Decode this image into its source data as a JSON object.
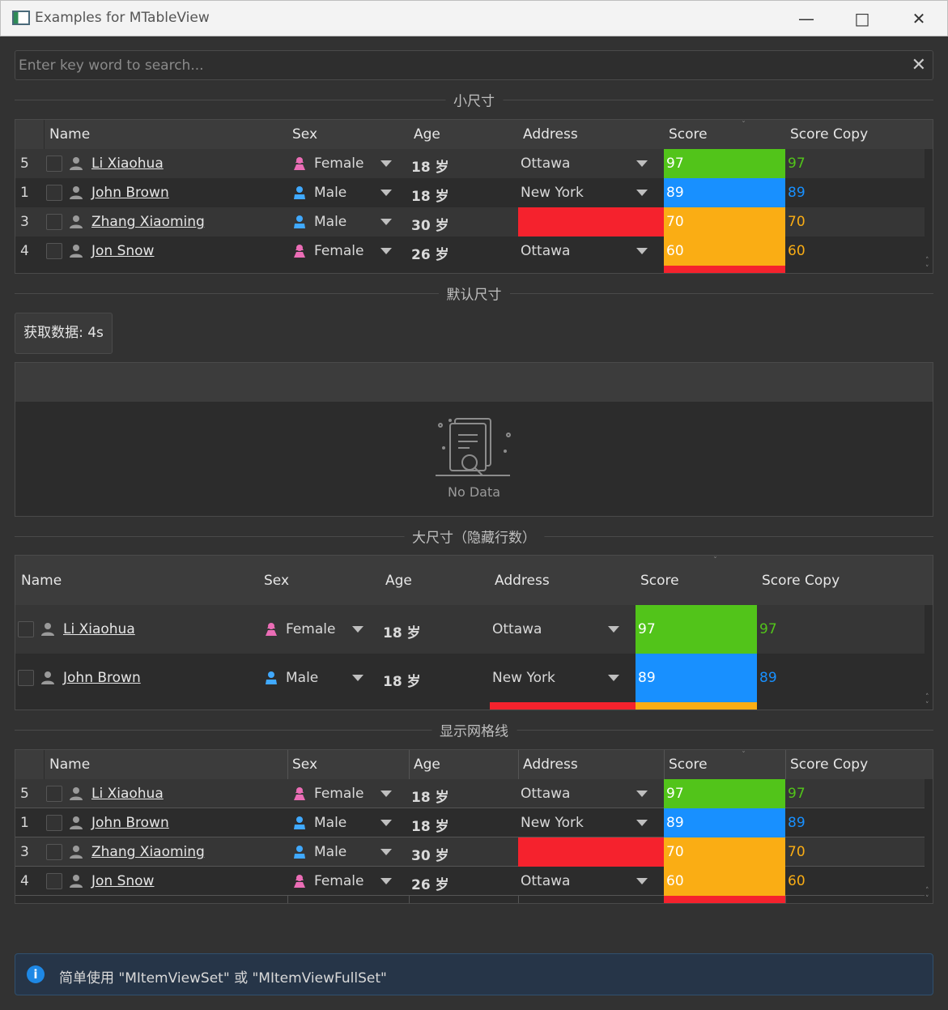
{
  "window": {
    "title": "Examples for MTableView"
  },
  "search": {
    "placeholder": "Enter key word to search..."
  },
  "sections": {
    "small": "小尺寸",
    "default": "默认尺寸",
    "large": "大尺寸（隐藏行数）",
    "grid": "显示网格线"
  },
  "fetch_button": "获取数据: 4s",
  "no_data": "No Data",
  "columns": [
    "Name",
    "Sex",
    "Age",
    "Address",
    "Score",
    "Score Copy"
  ],
  "rows": [
    {
      "index": "5",
      "name": "Li Xiaohua",
      "sex": "Female",
      "age": "18 岁",
      "address": "Ottawa",
      "score": "97",
      "score_copy": "97"
    },
    {
      "index": "1",
      "name": "John Brown",
      "sex": "Male",
      "age": "18 岁",
      "address": "New York",
      "score": "89",
      "score_copy": "89"
    },
    {
      "index": "3",
      "name": "Zhang Xiaoming",
      "sex": "Male",
      "age": "30 岁",
      "address": "",
      "score": "70",
      "score_copy": "70"
    },
    {
      "index": "4",
      "name": "Jon Snow",
      "sex": "Female",
      "age": "26 岁",
      "address": "Ottawa",
      "score": "60",
      "score_copy": "60"
    }
  ],
  "alert": {
    "message": "简单使用 \"MItemViewSet\" 或 \"MItemViewFullSet\""
  },
  "colors": {
    "green": "#52c41a",
    "blue": "#1890ff",
    "orange": "#faad14",
    "red": "#f5222d",
    "female": "#eb6db6",
    "male": "#40a9ff"
  }
}
